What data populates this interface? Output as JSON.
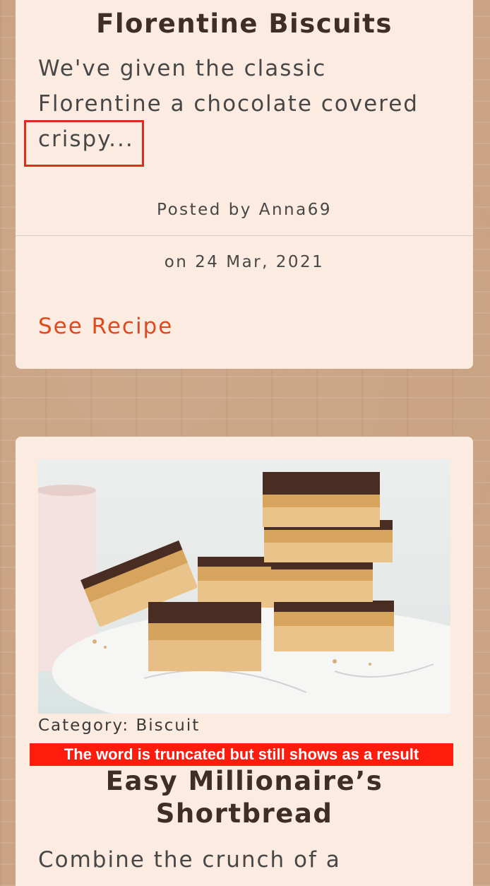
{
  "cards": [
    {
      "title": "Florentine Biscuits",
      "description": "We've given the classic Florentine a chocolate covered crispy...",
      "posted_by": "Posted by Anna69",
      "date": "on 24 Mar, 2021",
      "link_label": "See Recipe"
    },
    {
      "category": "Category: Biscuit",
      "title_line1": "Easy Millionaire’s",
      "title_line2": "Shortbread",
      "description": "Combine the crunch of a"
    }
  ],
  "annotation": {
    "text": "The word is truncated but still shows as a result"
  },
  "colors": {
    "card_background": "#fcebe0",
    "link": "#e0491e",
    "highlight": "#e02b1f",
    "annotation_background": "#ff1c0c"
  }
}
